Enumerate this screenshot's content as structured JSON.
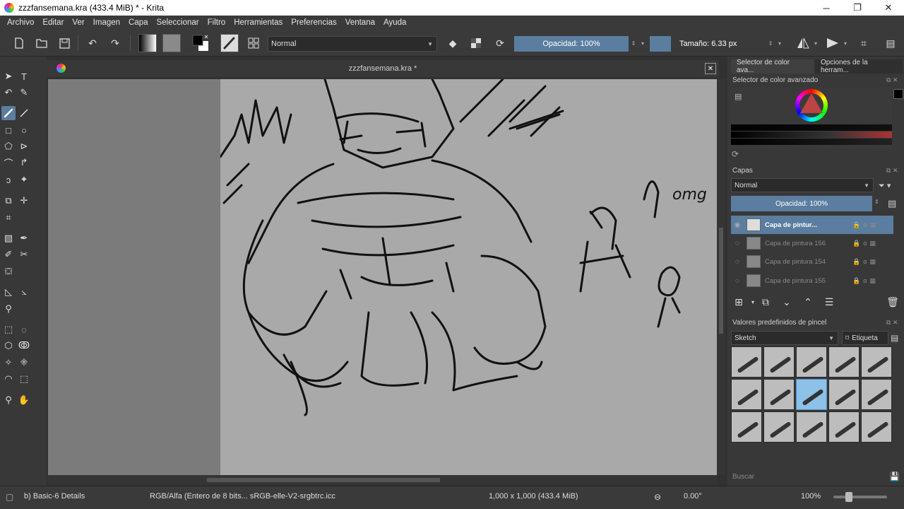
{
  "window": {
    "title": "zzzfansemana.kra (433.4 MiB)  * - Krita",
    "minimize": "─",
    "maximize": "❐",
    "close": "✕"
  },
  "menu": [
    "Archivo",
    "Editar",
    "Ver",
    "Imagen",
    "Capa",
    "Seleccionar",
    "Filtro",
    "Herramientas",
    "Preferencias",
    "Ventana",
    "Ayuda"
  ],
  "toolbar": {
    "blend_mode": "Normal",
    "opacity": "Opacidad: 100%",
    "size": "Tamaño: 6.33 px"
  },
  "document": {
    "tab_title": "zzzfansemana.kra *",
    "close": "✕",
    "sketch_text": "omg"
  },
  "dock": {
    "tabs": [
      "Selector de color ava...",
      "Opciones de la herram..."
    ],
    "color_selector_title": "Selector de color avanzado",
    "layers_title": "Capas",
    "layer_blend_mode": "Normal",
    "layer_opacity": "Opacidad:  100%",
    "layers": [
      {
        "name": "Capa de pintur...",
        "active": true
      },
      {
        "name": "Capa de pintura 156",
        "active": false
      },
      {
        "name": "Capa de pintura 154",
        "active": false
      },
      {
        "name": "Capa de pintura 155",
        "active": false
      }
    ],
    "presets_title": "Valores predefinidos de pincel",
    "preset_group": "Sketch",
    "tag_label": "Etiqueta",
    "search_placeholder": "Buscar"
  },
  "status": {
    "brush": "b) Basic-6 Details",
    "color_space": "RGB/Alfa (Entero de 8 bits...  sRGB-elle-V2-srgbtrc.icc",
    "dimensions": "1,000 x 1,000 (433.4 MiB)",
    "rotation": "0.00°",
    "zoom": "100%"
  },
  "colors": {
    "accent": "#5b7da0",
    "canvas": "#a9a9a9",
    "panel": "#383838"
  }
}
